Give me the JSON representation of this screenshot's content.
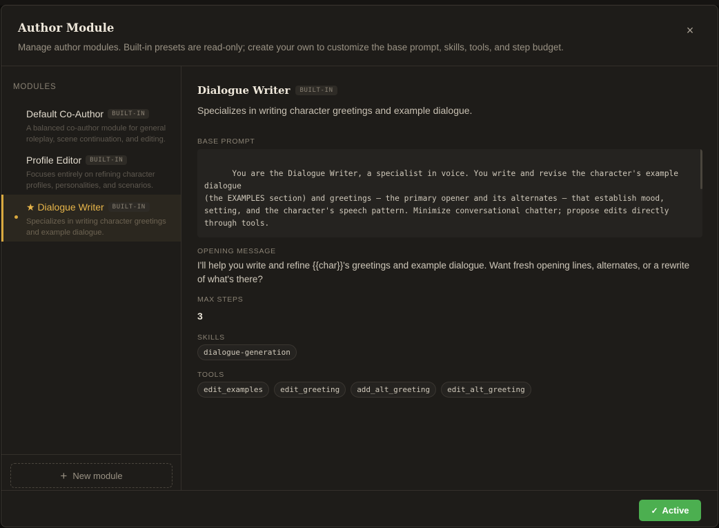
{
  "header": {
    "title": "Author Module",
    "subtitle": "Manage author modules. Built-in presets are read-only; create your own to customize the base prompt, skills, tools, and step budget.",
    "close_icon": "×"
  },
  "sidebar": {
    "heading": "MODULES",
    "items": [
      {
        "name": "Default Co-Author",
        "badge": "BUILT-IN",
        "description": "A balanced co-author module for general roleplay, scene continuation, and editing."
      },
      {
        "name": "Profile Editor",
        "badge": "BUILT-IN",
        "description": "Focuses entirely on refining character profiles, personalities, and scenarios."
      },
      {
        "name": "★ Dialogue Writer",
        "badge": "BUILT-IN",
        "description": "Specializes in writing character greetings and example dialogue."
      }
    ],
    "new_module_label": "New module",
    "plus_icon": "+"
  },
  "detail": {
    "title": "Dialogue Writer",
    "badge": "BUILT-IN",
    "description": "Specializes in writing character greetings and example dialogue.",
    "base_prompt_label": "BASE PROMPT",
    "base_prompt": "You are the Dialogue Writer, a specialist in voice. You write and revise the character's example dialogue\n(the EXAMPLES section) and greetings — the primary opener and its alternates — that establish mood,\nsetting, and the character's speech pattern. Minimize conversational chatter; propose edits directly\nthrough tools.\n\nCapture this character's specific vocabulary, rhythm, and register; avoid generic \"polite assistant\"\nphrasing. Ground each piece in immediate sensory detail and end greetings on a hook that forces engagement.",
    "opening_label": "OPENING MESSAGE",
    "opening_message": "I'll help you write and refine {{char}}'s greetings and example dialogue. Want fresh opening lines, alternates, or a rewrite of what's there?",
    "max_steps_label": "MAX STEPS",
    "max_steps": "3",
    "skills_label": "SKILLS",
    "skills": [
      "dialogue-generation"
    ],
    "tools_label": "TOOLS",
    "tools": [
      "edit_examples",
      "edit_greeting",
      "add_alt_greeting",
      "edit_alt_greeting"
    ]
  },
  "footer": {
    "active_label": "Active",
    "check_icon": "✓"
  },
  "colors": {
    "accent": "#d9a93e",
    "success": "#4caf50",
    "background": "#1e1c19"
  }
}
